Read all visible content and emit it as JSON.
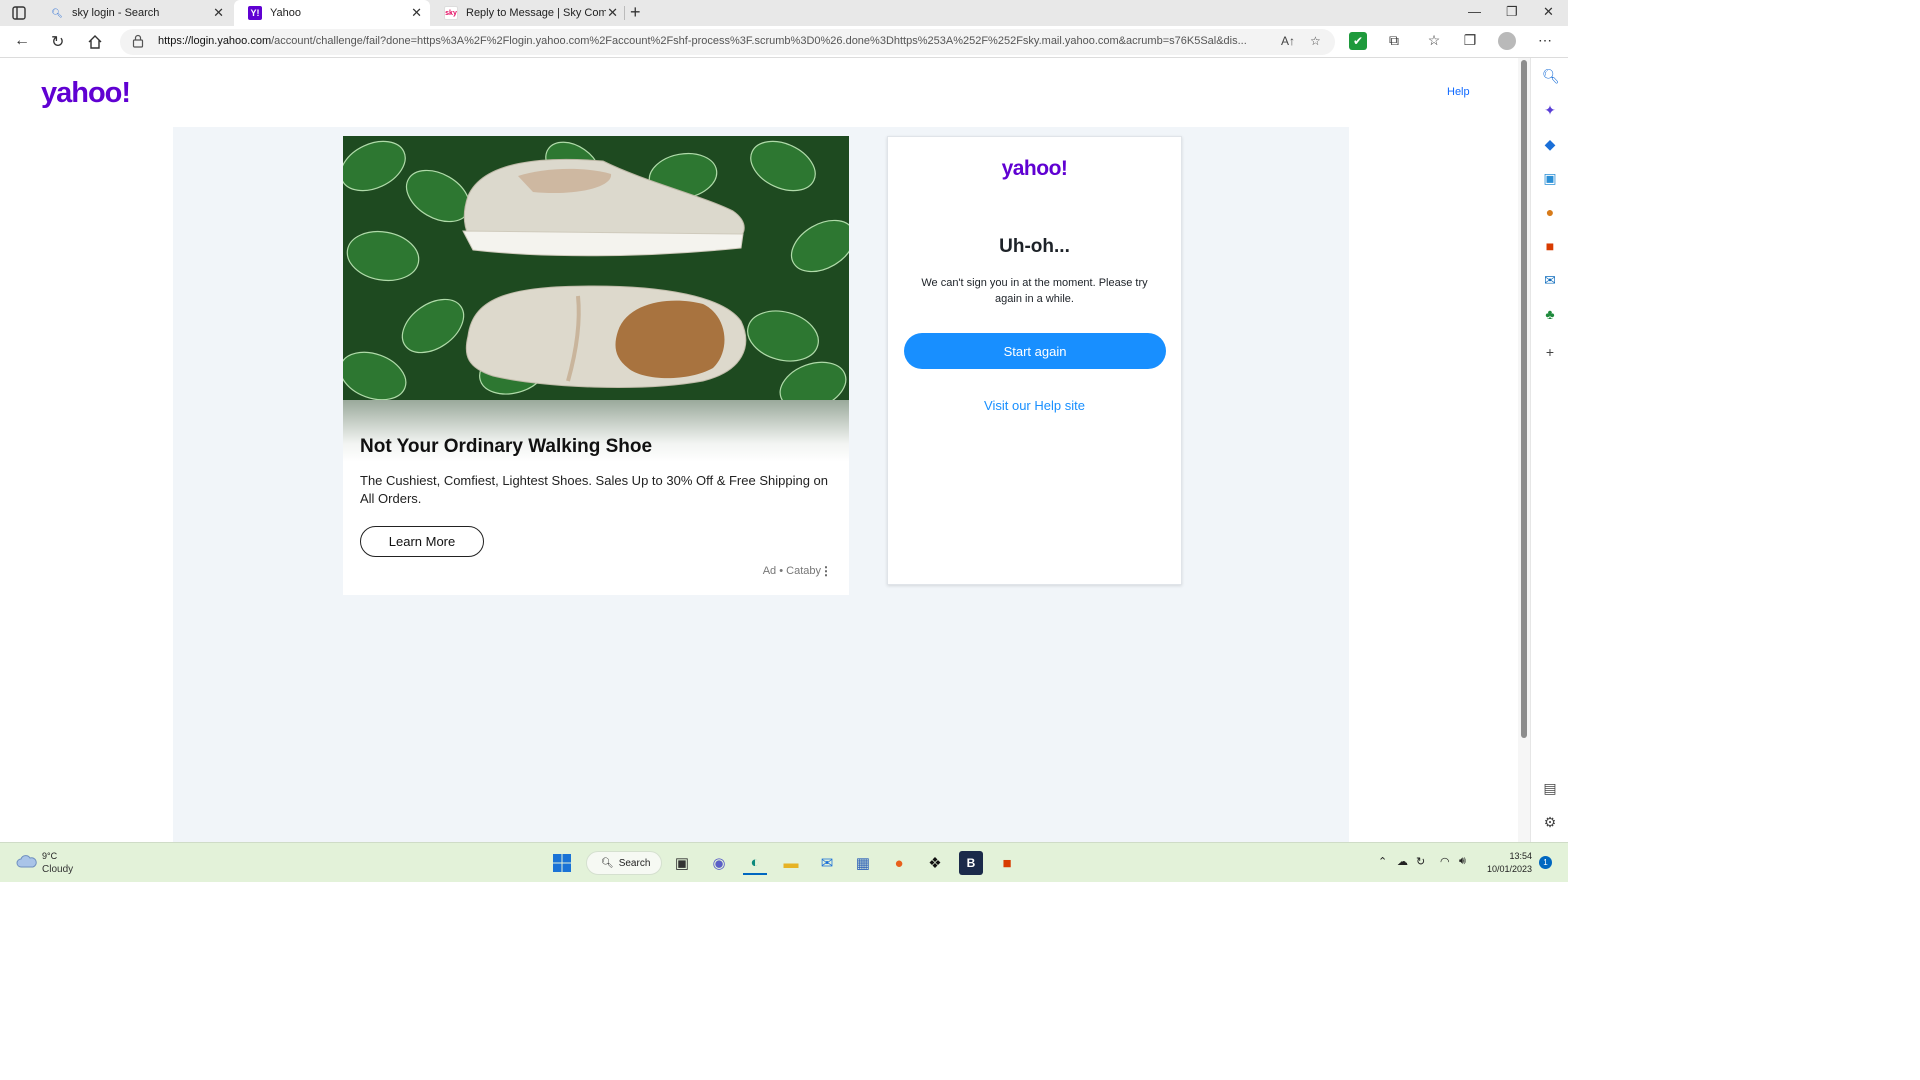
{
  "browser": {
    "tabs": [
      {
        "title": "sky login - Search",
        "favicon": "search-icon"
      },
      {
        "title": "Yahoo",
        "favicon": "yahoo-icon"
      },
      {
        "title": "Reply to Message | Sky Commun",
        "favicon": "sky-icon"
      }
    ],
    "url_host": "https://login.yahoo.com",
    "url_path": "/account/challenge/fail?done=https%3A%2F%2Flogin.yahoo.com%2Faccount%2Fshf-process%3F.scrumb%3D0%26.done%3Dhttps%253A%252F%252Fsky.mail.yahoo.com&acrumb=s76K5Sal&dis...",
    "read_aloud_glyph": "A↑"
  },
  "page": {
    "logo": "yahoo!",
    "help_link": "Help"
  },
  "ad": {
    "title": "Not Your Ordinary Walking Shoe",
    "description": "The Cushiest, Comfiest, Lightest Shoes. Sales Up to 30% Off & Free Shipping on All Orders.",
    "cta": "Learn More",
    "source": "Ad • Cataby",
    "menu_glyph": "⋮"
  },
  "login_card": {
    "logo": "yahoo!",
    "heading": "Uh-oh...",
    "message": "We can't sign you in at the moment. Please try again in a while.",
    "start_button": "Start again",
    "help_site_link": "Visit our Help site"
  },
  "taskbar": {
    "temperature": "9°C",
    "weather": "Cloudy",
    "search_label": "Search",
    "time": "13:54",
    "date": "10/01/2023",
    "notifications": "1"
  },
  "colors": {
    "yahoo_purple": "#6001d2",
    "yahoo_blue": "#188fff",
    "content_bg": "#f1f5f9",
    "taskbar_bg": "#e3f2d9"
  }
}
